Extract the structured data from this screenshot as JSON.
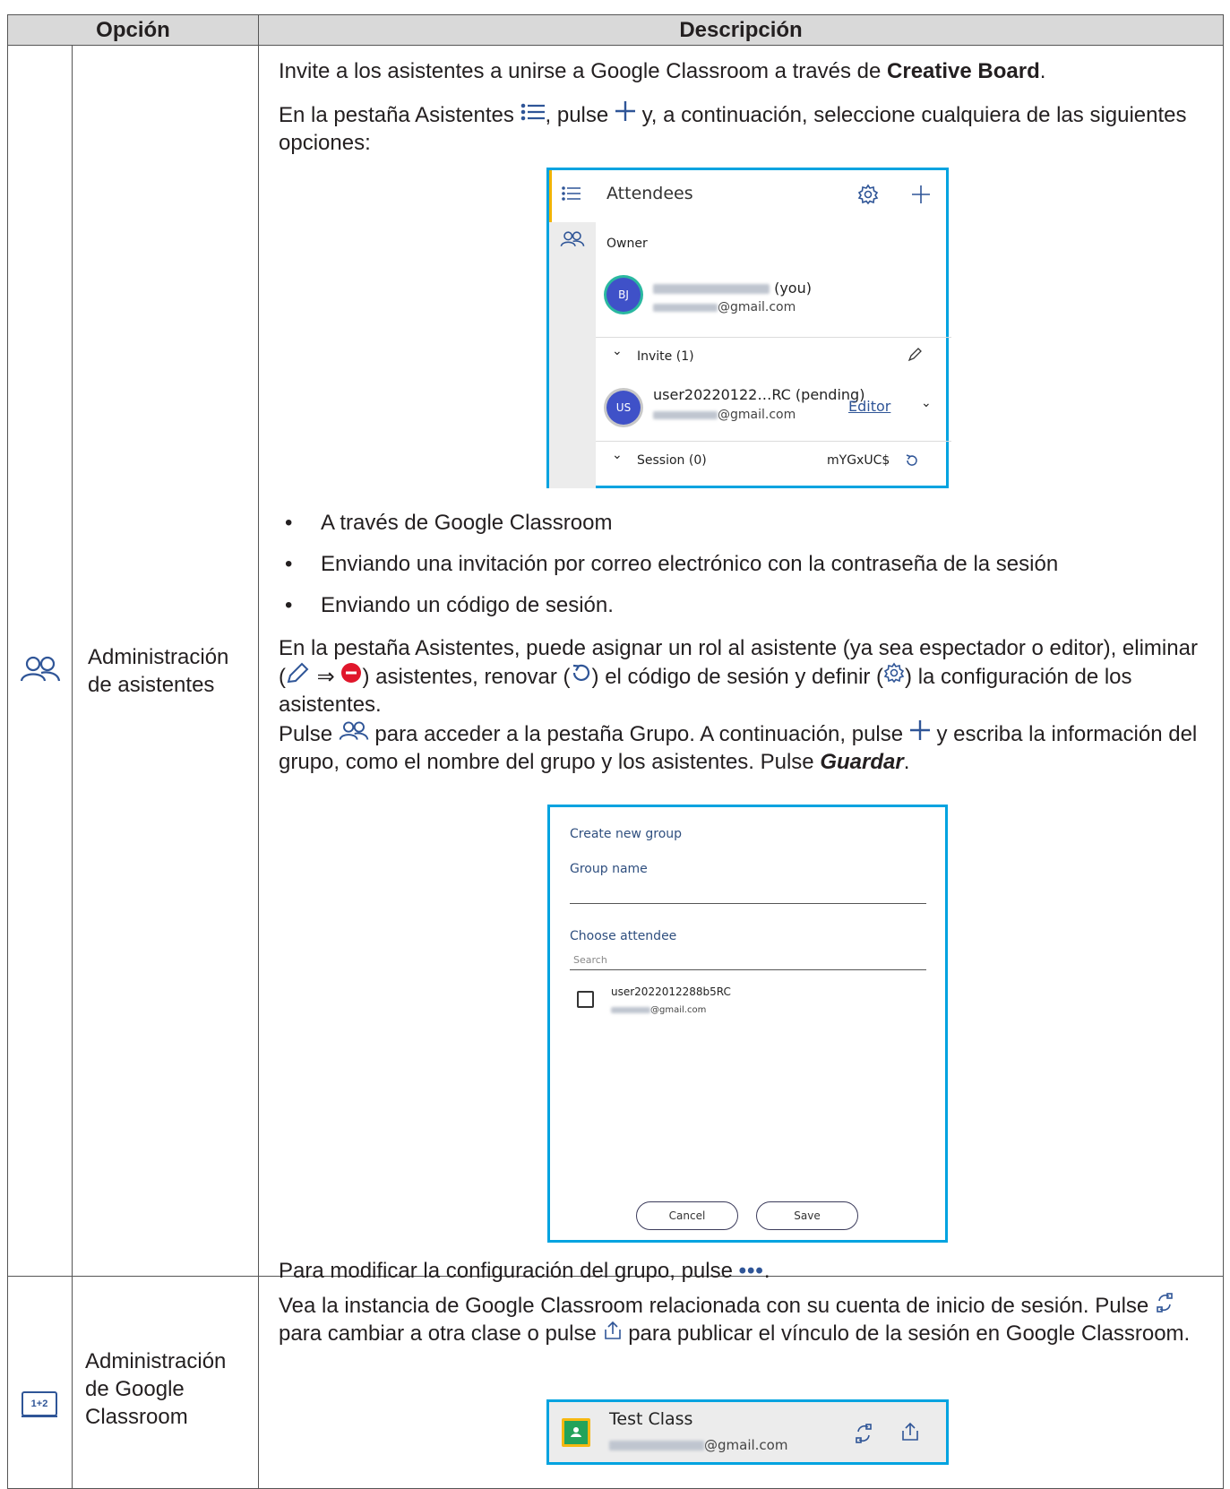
{
  "table": {
    "header_option": "Opción",
    "header_description": "Descripción"
  },
  "row1": {
    "icon": "people-icon",
    "option": "Administración de asistentes",
    "p1_text": "Invite a los asistentes a unirse a Google Classroom a través de ",
    "p1_bold": "Creative Board",
    "p1_end": ".",
    "p2_a": "En la pestaña Asistentes ",
    "p2_b": ", pulse ",
    "p2_c": " y, a continuación, seleccione cualquiera de las siguientes opciones:",
    "bullets": [
      "A través de Google Classroom",
      "Enviando una invitación por correo electrónico con la contraseña de la sesión",
      "Enviando un código de sesión."
    ],
    "p3_a": "En la pestaña Asistentes, puede asignar un rol al asistente (ya sea espectador o editor), eliminar (",
    "p3_b": ") asistentes, renovar (",
    "p3_c": ") el código de sesión y definir (",
    "p3_d": ") la configuración de los asistentes.",
    "p4_a": "Pulse ",
    "p4_b": " para acceder a la pestaña Grupo. A continuación, pulse ",
    "p4_c": " y escriba la información del grupo, como el nombre del grupo y los asistentes. Pulse ",
    "p4_bold": "Guardar",
    "p4_end": ".",
    "p5_a": "Para modificar la configuración del grupo, pulse ",
    "p5_end": "."
  },
  "attendees_panel": {
    "title": "Attendees",
    "owner_label": "Owner",
    "owner_initials": "BJ",
    "owner_suffix": "(you)",
    "owner_email_suffix": "@gmail.com",
    "invite_label": "Invite (1)",
    "user_initials": "US",
    "user_name": "user20220122…RC (pending)",
    "user_role": "Editor",
    "user_email_suffix": "@gmail.com",
    "session_label": "Session (0)",
    "session_code": "mYGxUC$"
  },
  "group_panel": {
    "title": "Create new group",
    "group_name_label": "Group name",
    "choose_label": "Choose attendee",
    "search_placeholder": "Search",
    "attendee_name": "user2022012288b5RC",
    "attendee_email_suffix": "@gmail.com",
    "cancel_label": "Cancel",
    "save_label": "Save"
  },
  "row2": {
    "icon": "classroom-board-icon",
    "icon_text": "1+2",
    "option": "Administración de Google Classroom",
    "p1_a": "Vea la instancia de Google Classroom relacionada con su cuenta de inicio de sesión. Pulse ",
    "p1_b": " para cambiar a otra clase o pulse ",
    "p1_c": " para publicar el vínculo de la sesión en Google Classroom."
  },
  "class_bar": {
    "class_name": "Test Class",
    "email_suffix": "@gmail.com"
  },
  "colors": {
    "accent_blue": "#2f5597",
    "frame_blue": "#00a3e0",
    "avatar_blue": "#3f51c8",
    "delete_red": "#e0162b",
    "header_gray": "#d9d9d9"
  }
}
